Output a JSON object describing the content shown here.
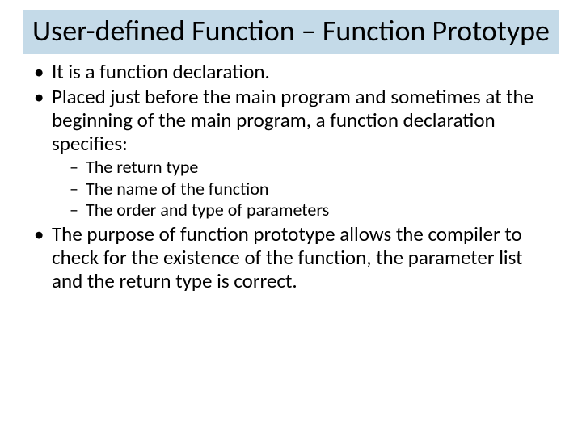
{
  "title": "User-defined Function – Function Prototype",
  "bullets": {
    "b1": "It is a function declaration.",
    "b2": "Placed just before the main program and sometimes at the beginning of the main program, a function declaration specifies:",
    "sub": {
      "s1": "The return type",
      "s2": "The name of the function",
      "s3": "The order and type of parameters"
    },
    "b3": "The purpose of function prototype allows the compiler to check for the existence of the function, the parameter list and the return type is correct."
  }
}
